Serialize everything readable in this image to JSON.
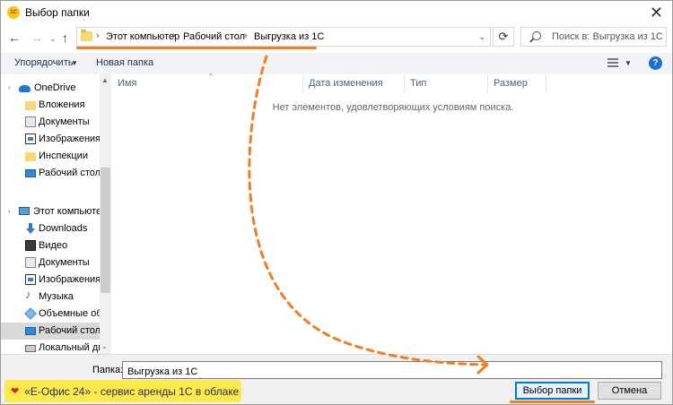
{
  "window": {
    "title": "Выбор папки",
    "app_icon_text": "1С",
    "close_glyph": "✕"
  },
  "nav": {
    "back": "←",
    "forward": "→",
    "history": "⌄",
    "up": "↑",
    "breadcrumbs": [
      "Этот компьютер",
      "Рабочий стол",
      "Выгрузка из 1С"
    ],
    "separator": "›",
    "refresh": "⟳",
    "search_placeholder": "Поиск в: Выгрузка из 1С"
  },
  "toolbar": {
    "organize_label": "Упорядочить",
    "new_folder_label": "Новая папка",
    "help": "?"
  },
  "sidebar": {
    "items": [
      {
        "label": "OneDrive",
        "icon": "onedrive-icon"
      },
      {
        "label": "Вложения",
        "icon": "folder-icon"
      },
      {
        "label": "Документы",
        "icon": "documents-icon"
      },
      {
        "label": "Изображения",
        "icon": "images-icon"
      },
      {
        "label": "Инспекции",
        "icon": "folder-icon"
      },
      {
        "label": "Рабочий стол",
        "icon": "desktop-icon"
      },
      {
        "label": "Этот компьютер",
        "icon": "computer-icon"
      },
      {
        "label": "Downloads",
        "icon": "downloads-icon"
      },
      {
        "label": "Видео",
        "icon": "video-icon"
      },
      {
        "label": "Документы",
        "icon": "documents-icon"
      },
      {
        "label": "Изображения",
        "icon": "images-icon"
      },
      {
        "label": "Музыка",
        "icon": "music-icon"
      },
      {
        "label": "Объемные объ",
        "icon": "3d-objects-icon"
      },
      {
        "label": "Рабочий стол",
        "icon": "desktop-icon"
      },
      {
        "label": "Локальный дис",
        "icon": "disk-icon"
      }
    ],
    "selected_index": 13
  },
  "list": {
    "columns": [
      "Имя",
      "Дата изменения",
      "Тип",
      "Размер"
    ],
    "empty_message": "Нет элементов, удовлетворяющих условиям поиска."
  },
  "footer": {
    "folder_label": "Папка:",
    "folder_value": "Выгрузка из 1С",
    "select_button": "Выбор папки",
    "cancel_button": "Отмена"
  },
  "promo": {
    "heart": "❤",
    "text": "«Е-Офис 24» - сервис аренды 1С в облаке"
  },
  "colors": {
    "accent_annotation": "#f57c20",
    "promo_bg": "#ffe84a",
    "focus_blue": "#0078d7"
  }
}
